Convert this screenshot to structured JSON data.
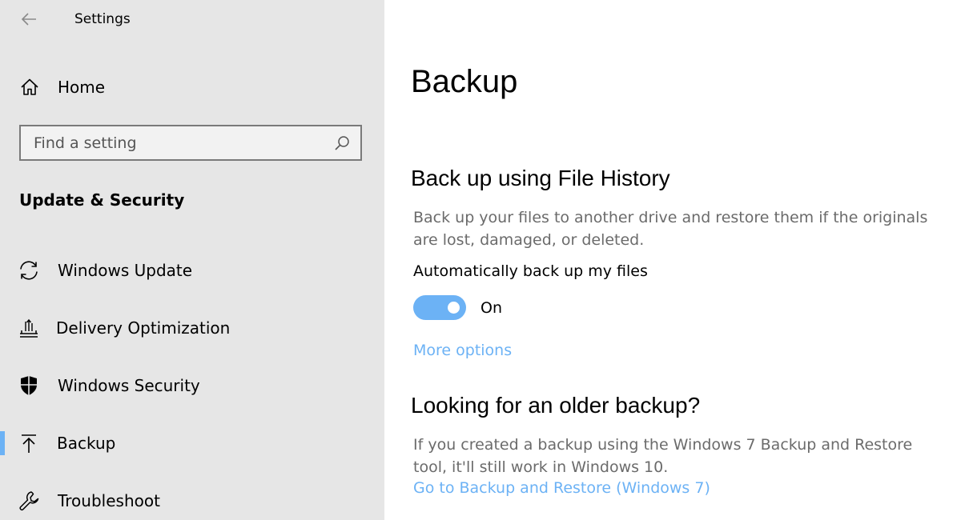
{
  "app": {
    "title": "Settings"
  },
  "sidebar": {
    "home_label": "Home",
    "search": {
      "placeholder": "Find a setting",
      "value": ""
    },
    "section_heading": "Update & Security",
    "items": [
      {
        "label": "Windows Update",
        "icon": "sync-icon"
      },
      {
        "label": "Delivery Optimization",
        "icon": "upload-tray-icon"
      },
      {
        "label": "Windows Security",
        "icon": "shield-icon"
      },
      {
        "label": "Backup",
        "icon": "arrow-up-icon",
        "selected": true
      },
      {
        "label": "Troubleshoot",
        "icon": "wrench-icon"
      }
    ]
  },
  "main": {
    "title": "Backup",
    "file_history": {
      "heading": "Back up using File History",
      "description": "Back up your files to another drive and restore them if the originals are lost, damaged, or deleted.",
      "auto_label": "Automatically back up my files",
      "toggle_state": "On",
      "toggle_on": true,
      "more_options": "More options"
    },
    "older_backup": {
      "heading": "Looking for an older backup?",
      "description": "If you created a backup using the Windows 7 Backup and Restore tool, it'll still work in Windows 10.",
      "link": "Go to Backup and Restore (Windows 7)"
    }
  },
  "colors": {
    "accent": "#6cb2f5",
    "sidebar_bg": "#e6e6e6",
    "secondary_text": "#6b6b6b"
  }
}
